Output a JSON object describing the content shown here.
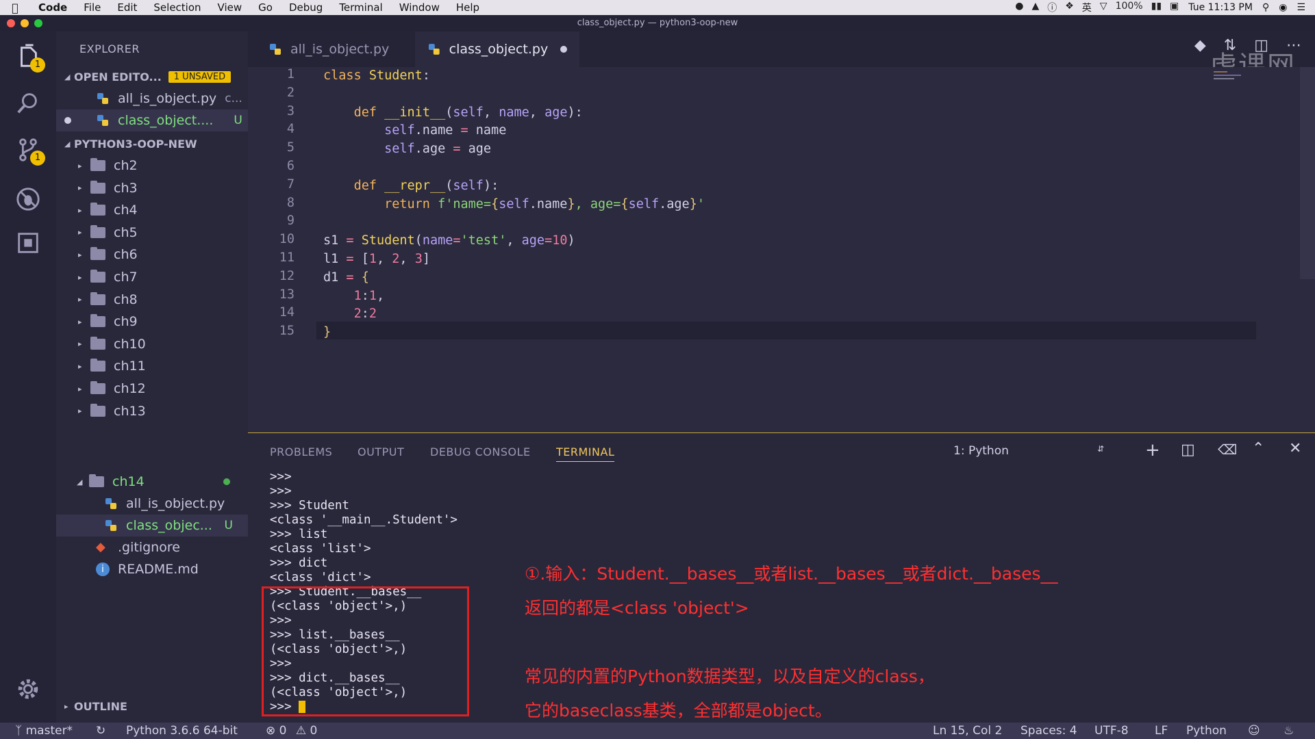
{
  "menubar": {
    "app": "Code",
    "items": [
      "File",
      "Edit",
      "Selection",
      "View",
      "Go",
      "Debug",
      "Terminal",
      "Window",
      "Help"
    ],
    "battery": "100%",
    "clock": "Tue 11:13 PM",
    "input_method": "英"
  },
  "window_title": "class_object.py — python3-oop-new",
  "watermark": "虎课网",
  "activity": {
    "explorer_badge": "1",
    "scm_badge": "1"
  },
  "sidebar": {
    "title": "EXPLORER",
    "open_editors": {
      "label": "OPEN EDITO...",
      "badge": "1 UNSAVED"
    },
    "open_files": [
      {
        "name": "all_is_object.py",
        "suffix": "c..."
      },
      {
        "name": "class_object....",
        "status": "U"
      }
    ],
    "project": "PYTHON3-OOP-NEW",
    "folders": [
      "ch2",
      "ch3",
      "ch4",
      "ch5",
      "ch6",
      "ch7",
      "ch8",
      "ch9",
      "ch10",
      "ch11",
      "ch12",
      "ch13",
      "ch14"
    ],
    "ch14_files": [
      {
        "name": "all_is_object.py"
      },
      {
        "name": "class_objec...",
        "status": "U"
      }
    ],
    "root_files": [
      ".gitignore",
      "README.md"
    ],
    "outline": "OUTLINE"
  },
  "tabs": [
    {
      "label": "all_is_object.py",
      "active": false
    },
    {
      "label": "class_object.py",
      "active": true,
      "dirty": true
    }
  ],
  "editor": {
    "line_numbers": [
      "1",
      "2",
      "3",
      "4",
      "5",
      "6",
      "7",
      "8",
      "9",
      "10",
      "11",
      "12",
      "13",
      "14",
      "15"
    ]
  },
  "panel": {
    "tabs": [
      "PROBLEMS",
      "OUTPUT",
      "DEBUG CONSOLE",
      "TERMINAL"
    ],
    "active_tab": "TERMINAL",
    "terminal_select": "1: Python",
    "terminal_lines": [
      ">>>",
      ">>>",
      ">>> Student",
      "<class '__main__.Student'>",
      ">>> list",
      "<class 'list'>",
      ">>> dict",
      "<class 'dict'>",
      ">>> Student.__bases__",
      "(<class 'object'>,)",
      ">>>",
      ">>> list.__bases__",
      "(<class 'object'>,)",
      ">>>",
      ">>> dict.__bases__",
      "(<class 'object'>,)",
      ">>> "
    ],
    "notes": [
      "①.输入：Student.__bases__或者list.__bases__或者dict.__bases__",
      "返回的都是<class 'object'>",
      "常见的内置的Python数据类型，以及自定义的class，",
      "它的baseclass基类，全部都是object。"
    ]
  },
  "status": {
    "branch": "master*",
    "interpreter": "Python 3.6.6 64-bit",
    "errors": "0",
    "warnings": "0",
    "position": "Ln 15, Col 2",
    "spaces": "Spaces: 4",
    "encoding": "UTF-8",
    "eol": "LF",
    "language": "Python"
  }
}
